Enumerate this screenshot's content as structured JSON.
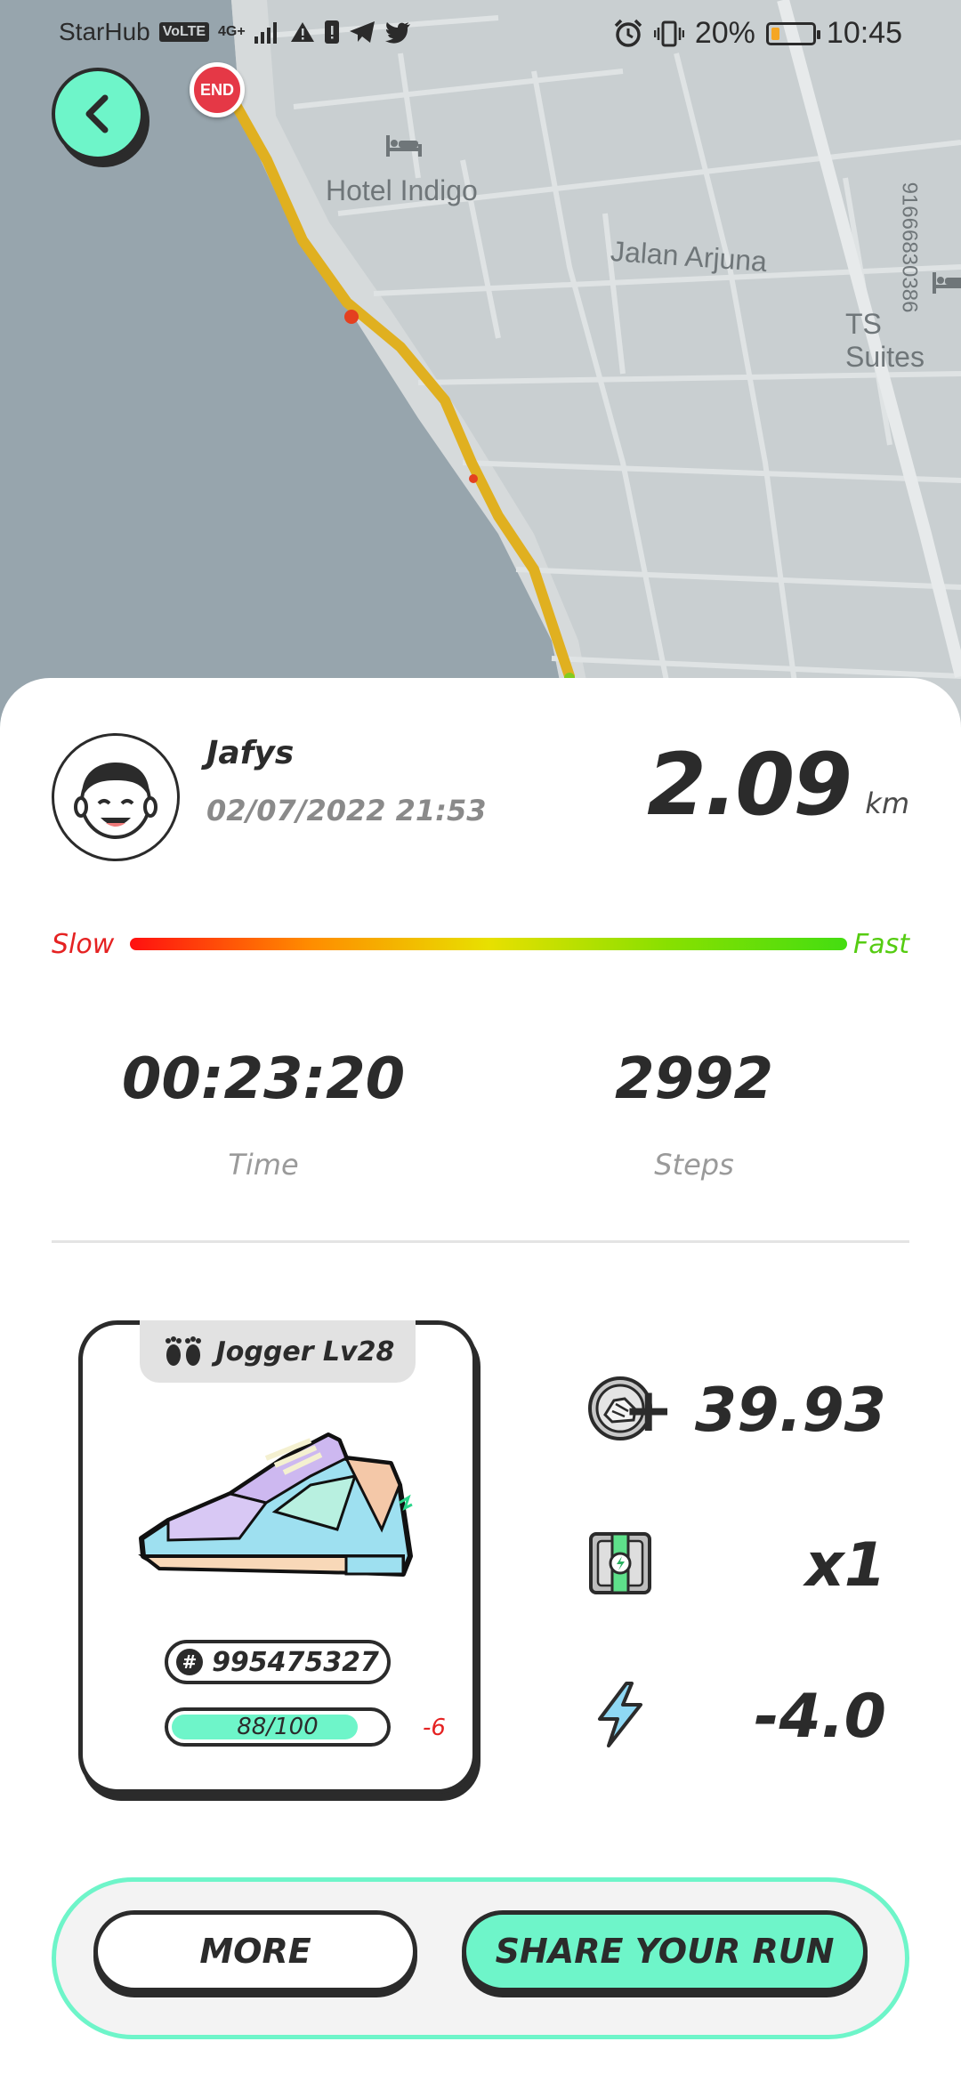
{
  "status_bar": {
    "carrier": "StarHub",
    "volte": "VoLTE",
    "network": "4G+",
    "battery_percent": "20%",
    "battery_level": 0.2,
    "time": "10:45"
  },
  "map": {
    "end_marker": "END",
    "labels": {
      "hotel_indigo": "Hotel Indigo",
      "jalan_arjuna": "Jalan Arjuna",
      "ts_suites": "TS Suites",
      "vertical_number": "91666830386"
    }
  },
  "run": {
    "user_name": "Jafys",
    "date": "02/07/2022 21:53",
    "distance": "2.09",
    "distance_unit": "km",
    "speed_slow": "Slow",
    "speed_fast": "Fast",
    "time_value": "00:23:20",
    "time_label": "Time",
    "steps_value": "2992",
    "steps_label": "Steps"
  },
  "sneaker": {
    "type_level": "Jogger Lv28",
    "id_symbol": "#",
    "id": "995475327",
    "durability": "88/100",
    "durability_fraction": 0.88,
    "durability_change": "-6"
  },
  "rewards": {
    "gst": "+ 39.93",
    "mystery_box": "x1",
    "energy": "-4.0"
  },
  "buttons": {
    "more": "MORE",
    "share": "SHARE YOUR RUN"
  },
  "colors": {
    "accent": "#6ef5c9",
    "dark": "#2b2b2b",
    "slow": "#e52222",
    "fast": "#55cc11",
    "route": "#e0b020"
  }
}
